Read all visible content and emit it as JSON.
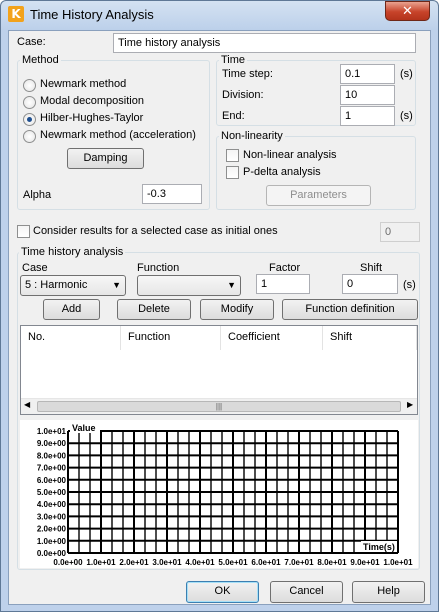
{
  "window": {
    "title": "Time History Analysis",
    "close_glyph": "✕",
    "icon_letter": "K"
  },
  "case": {
    "label": "Case:",
    "value": "Time history analysis"
  },
  "method": {
    "title": "Method",
    "options": [
      {
        "label": "Newmark method",
        "checked": false
      },
      {
        "label": "Modal decomposition",
        "checked": false
      },
      {
        "label": "Hilber-Hughes-Taylor",
        "checked": true
      },
      {
        "label": "Newmark method (acceleration)",
        "checked": false
      }
    ],
    "damping_button": "Damping",
    "alpha_label": "Alpha",
    "alpha_value": "-0.3"
  },
  "time": {
    "title": "Time",
    "step_label": "Time step:",
    "step_value": "0.1",
    "step_unit": "(s)",
    "division_label": "Division:",
    "division_value": "10",
    "end_label": "End:",
    "end_value": "1",
    "end_unit": "(s)"
  },
  "nonlinearity": {
    "title": "Non-linearity",
    "nonlinear_label": "Non-linear analysis",
    "pdelta_label": "P-delta analysis",
    "parameters_button": "Parameters"
  },
  "initial": {
    "label": "Consider results for a selected case as initial ones",
    "value": "0"
  },
  "tha": {
    "title": "Time history analysis",
    "case_label": "Case",
    "case_value": "5 : Harmonic",
    "function_label": "Function",
    "function_value": "",
    "factor_label": "Factor",
    "factor_value": "1",
    "shift_label": "Shift",
    "shift_value": "0",
    "shift_unit": "(s)",
    "buttons": {
      "add": "Add",
      "delete": "Delete",
      "modify": "Modify",
      "function_definition": "Function definition"
    },
    "columns": [
      "No.",
      "Function",
      "Coefficient",
      "Shift"
    ],
    "scroll_thumb": "|||"
  },
  "footer": {
    "ok": "OK",
    "cancel": "Cancel",
    "help": "Help"
  },
  "chart_data": {
    "type": "line",
    "title": "",
    "xlabel": "Time(s)",
    "ylabel": "Value",
    "xlim": [
      0,
      1
    ],
    "ylim": [
      0,
      1
    ],
    "grid": true,
    "x_ticks": [
      "0.0e+00",
      "1.0e+01",
      "2.0e+01",
      "3.0e+01",
      "4.0e+01",
      "5.0e+01",
      "6.0e+01",
      "7.0e+01",
      "8.0e+01",
      "9.0e+01",
      "1.0e+01"
    ],
    "y_ticks": [
      "0.0e+00",
      "1.0e+00",
      "2.0e+00",
      "3.0e+00",
      "4.0e+00",
      "5.0e+00",
      "6.0e+00",
      "7.0e+00",
      "8.0e+00",
      "9.0e+00",
      "1.0e+01"
    ],
    "series": []
  }
}
